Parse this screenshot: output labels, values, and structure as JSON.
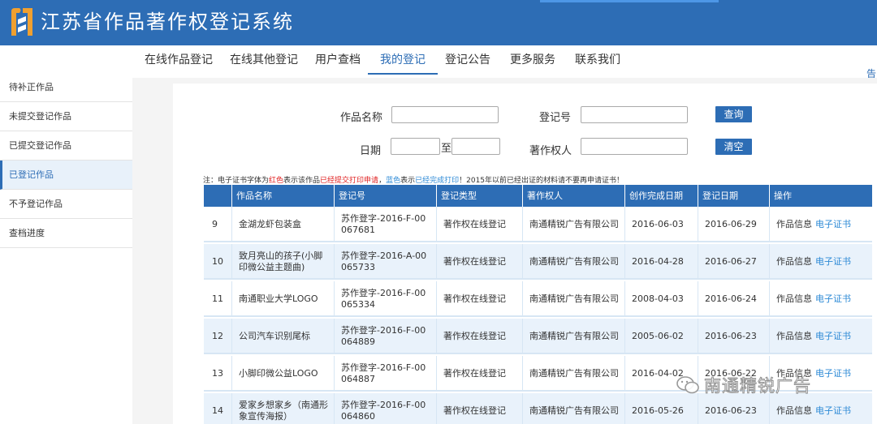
{
  "header": {
    "title": "江苏省作品著作权登记系统"
  },
  "nav": {
    "items": [
      {
        "label": "在线作品登记"
      },
      {
        "label": "在线其他登记"
      },
      {
        "label": "用户查档"
      },
      {
        "label": "我的登记"
      },
      {
        "label": "登记公告"
      },
      {
        "label": "更多服务"
      },
      {
        "label": "联系我们"
      }
    ],
    "edge_text": "告"
  },
  "sidebar": {
    "items": [
      {
        "label": "待补正作品"
      },
      {
        "label": "未提交登记作品"
      },
      {
        "label": "已提交登记作品"
      },
      {
        "label": "已登记作品"
      },
      {
        "label": "不予登记作品"
      },
      {
        "label": "查档进度"
      }
    ]
  },
  "search": {
    "work_name_label": "作品名称",
    "reg_no_label": "登记号",
    "date_label": "日期",
    "to_label": "至",
    "owner_label": "著作权人",
    "query_button": "查询",
    "clear_button": "清空"
  },
  "note": {
    "part1": "注：电子证书字体为",
    "red_word": "红色",
    "part2": "表示该作品",
    "red_phrase": "已经提交打印申请",
    "part3": "，",
    "blue_word": "蓝色",
    "part4": "表示",
    "blue_phrase": "已经完成打印",
    "part5": "！2015年以前已经出证的材料请不要再申请证书！"
  },
  "table": {
    "headers": [
      "作品名称",
      "登记号",
      "登记类型",
      "著作权人",
      "创作完成日期",
      "登记日期",
      "操作"
    ],
    "rows": [
      {
        "num": "9",
        "name": "金湖龙虾包装盒",
        "reg_no": "苏作登字-2016-F-00067681",
        "type": "著作权在线登记",
        "owner": "南通精锐广告有限公司",
        "created": "2016-06-03",
        "reg_date": "2016-06-29",
        "op_info": "作品信息",
        "op_cert": "电子证书"
      },
      {
        "num": "10",
        "name": "致月亮山的孩子(小脚印微公益主题曲)",
        "reg_no": "苏作登字-2016-A-00065733",
        "type": "著作权在线登记",
        "owner": "南通精锐广告有限公司",
        "created": "2016-04-28",
        "reg_date": "2016-06-27",
        "op_info": "作品信息",
        "op_cert": "电子证书"
      },
      {
        "num": "11",
        "name": "南通职业大学LOGO",
        "reg_no": "苏作登字-2016-F-00065334",
        "type": "著作权在线登记",
        "owner": "南通精锐广告有限公司",
        "created": "2008-04-03",
        "reg_date": "2016-06-24",
        "op_info": "作品信息",
        "op_cert": "电子证书"
      },
      {
        "num": "12",
        "name": "公司汽车识别尾标",
        "reg_no": "苏作登字-2016-F-00064889",
        "type": "著作权在线登记",
        "owner": "南通精锐广告有限公司",
        "created": "2005-06-02",
        "reg_date": "2016-06-23",
        "op_info": "作品信息",
        "op_cert": "电子证书"
      },
      {
        "num": "13",
        "name": "小脚印微公益LOGO",
        "reg_no": "苏作登字-2016-F-00064887",
        "type": "著作权在线登记",
        "owner": "南通精锐广告有限公司",
        "created": "2016-04-02",
        "reg_date": "2016-06-22",
        "op_info": "作品信息",
        "op_cert": "电子证书"
      },
      {
        "num": "14",
        "name": "爱家乡想家乡（南通形象宣传海报）",
        "reg_no": "苏作登字-2016-F-00064860",
        "type": "著作权在线登记",
        "owner": "南通精锐广告有限公司",
        "created": "2016-05-26",
        "reg_date": "2016-06-23",
        "op_info": "作品信息",
        "op_cert": "电子证书"
      }
    ]
  },
  "watermark": {
    "text": "南通精锐广告"
  },
  "colors": {
    "primary": "#2d6db5",
    "link": "#2d8ad6",
    "alert": "#e02020",
    "row_alt": "#e9f2fb"
  }
}
